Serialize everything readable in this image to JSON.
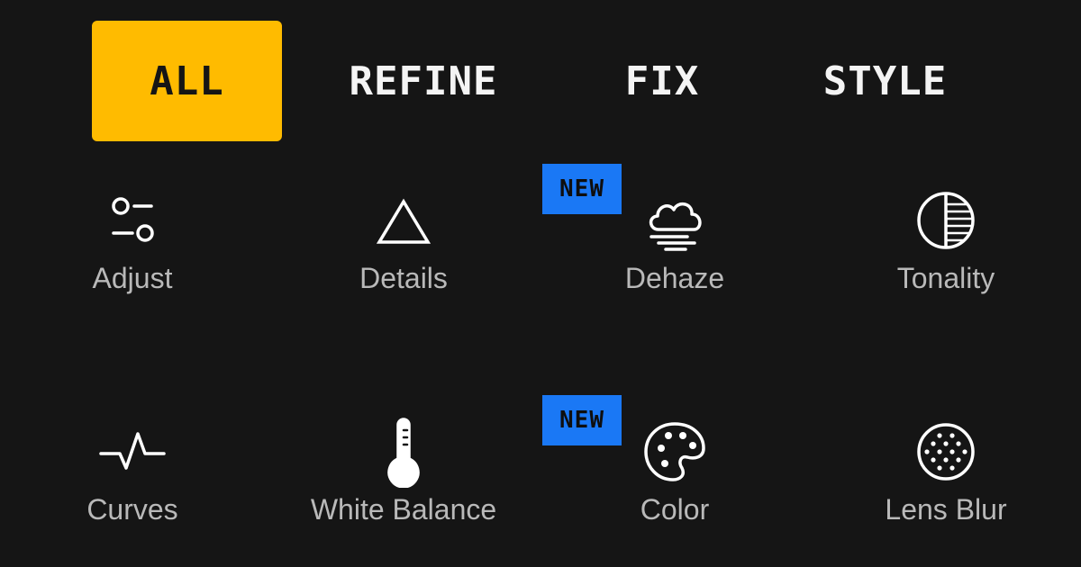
{
  "tabs": [
    {
      "label": "ALL",
      "active": true
    },
    {
      "label": "REFINE",
      "active": false
    },
    {
      "label": "FIX",
      "active": false
    },
    {
      "label": "STYLE",
      "active": false
    }
  ],
  "tools": {
    "adjust": {
      "label": "Adjust",
      "icon": "sliders-icon"
    },
    "details": {
      "label": "Details",
      "icon": "triangle-icon"
    },
    "dehaze": {
      "label": "Dehaze",
      "icon": "cloud-haze-icon",
      "badge": "NEW"
    },
    "tonality": {
      "label": "Tonality",
      "icon": "half-circle-icon"
    },
    "curves": {
      "label": "Curves",
      "icon": "curve-icon"
    },
    "white_balance": {
      "label": "White Balance",
      "icon": "thermometer-icon"
    },
    "color": {
      "label": "Color",
      "icon": "palette-icon",
      "badge": "NEW"
    },
    "lens_blur": {
      "label": "Lens Blur",
      "icon": "lens-blur-icon"
    }
  },
  "colors": {
    "background": "#151515",
    "accent": "#ffbb00",
    "badge": "#1a78f5",
    "tab_text": "#f4f4f4",
    "label_text": "#b9b9b9"
  }
}
